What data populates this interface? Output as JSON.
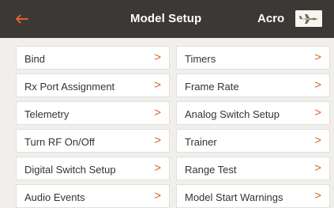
{
  "header": {
    "title": "Model Setup",
    "mode": "Acro",
    "back_icon": "back-arrow-icon",
    "accent_color": "#e2602c",
    "background_color": "#3c3836"
  },
  "menu": {
    "left": [
      {
        "label": "Bind"
      },
      {
        "label": "Rx Port Assignment"
      },
      {
        "label": "Telemetry"
      },
      {
        "label": "Turn RF On/Off"
      },
      {
        "label": "Digital Switch Setup"
      },
      {
        "label": "Audio Events"
      }
    ],
    "right": [
      {
        "label": "Timers"
      },
      {
        "label": "Frame Rate"
      },
      {
        "label": "Analog Switch Setup"
      },
      {
        "label": "Trainer"
      },
      {
        "label": "Range Test"
      },
      {
        "label": "Model Start Warnings"
      }
    ],
    "chevron": ">"
  }
}
